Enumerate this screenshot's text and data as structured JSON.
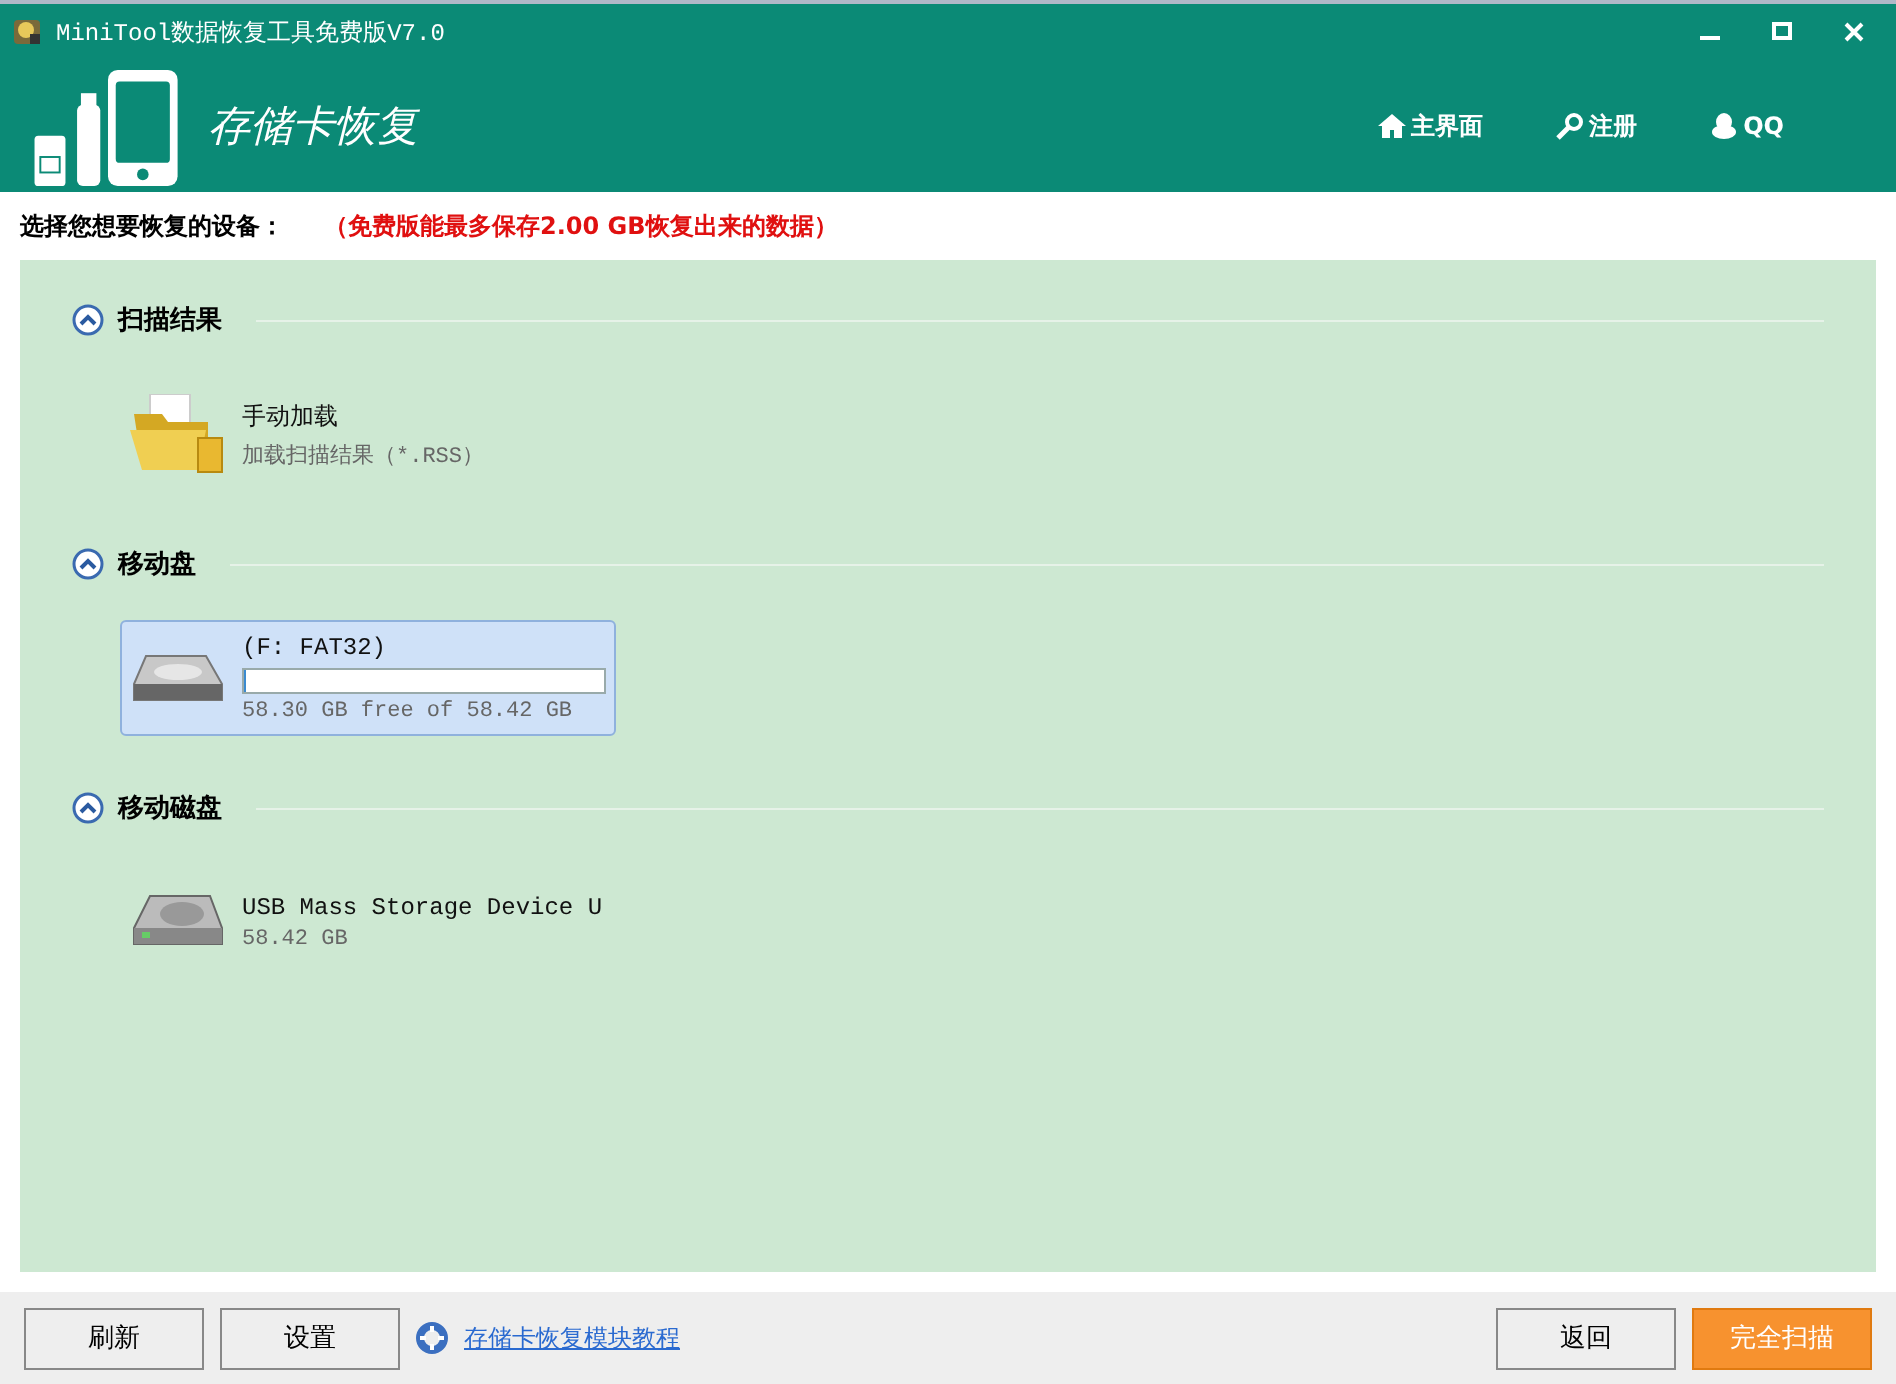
{
  "window": {
    "title": "MiniTool数据恢复工具免费版V7.0"
  },
  "header": {
    "title": "存储卡恢复",
    "nav": [
      {
        "kind": "home",
        "label": "主界面"
      },
      {
        "kind": "key",
        "label": "注册"
      },
      {
        "kind": "qq",
        "label": "QQ"
      }
    ]
  },
  "instruction": {
    "label": "选择您想要恢复的设备：",
    "note": "（免费版能最多保存2.00 GB恢复出来的数据）"
  },
  "sections": [
    {
      "title": "扫描结果",
      "expanded": true,
      "items": [
        {
          "kind": "load",
          "name": "手动加载",
          "detail": "加载扫描结果（*.RSS）",
          "selected": false
        }
      ]
    },
    {
      "title": "移动盘",
      "expanded": true,
      "items": [
        {
          "kind": "partition",
          "name": "(F: FAT32)",
          "detail": "58.30 GB free of 58.42 GB",
          "level": 0.002,
          "selected": true
        }
      ]
    },
    {
      "title": "移动磁盘",
      "expanded": true,
      "items": [
        {
          "kind": "disk",
          "name": "USB Mass Storage Device U",
          "detail": "58.42 GB",
          "selected": false
        }
      ]
    }
  ],
  "footer": {
    "left_buttons": [
      "刷新",
      "设置"
    ],
    "tutorial_link": "存储卡恢复模块教程",
    "back_button": "返回",
    "scan_button": "完全扫描"
  }
}
